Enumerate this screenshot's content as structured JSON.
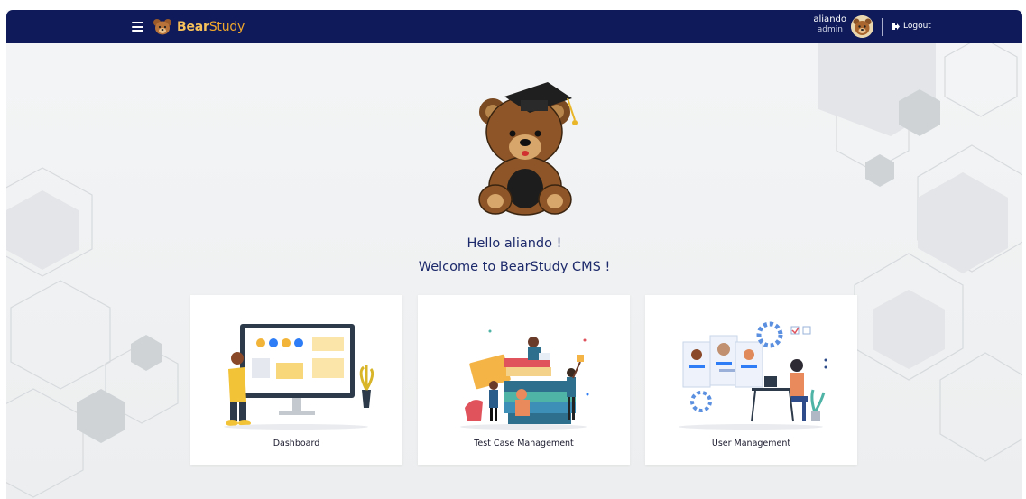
{
  "brand": {
    "bold": "Bear",
    "regular": "Study"
  },
  "user": {
    "name": "aliando",
    "role": "admin"
  },
  "logout_label": "Logout",
  "greeting": {
    "line1": "Hello aliando !",
    "line2": "Welcome to BearStudy CMS !"
  },
  "cards": [
    {
      "label": "Dashboard"
    },
    {
      "label": "Test Case Management"
    },
    {
      "label": "User Management"
    }
  ],
  "colors": {
    "navbar": "#0e1a5a",
    "brand_accent": "#f0a72b",
    "heading": "#1d2a6b",
    "background": "#eef0f1"
  },
  "icons": [
    "menu-icon",
    "bear-logo-icon",
    "avatar",
    "logout-icon"
  ]
}
